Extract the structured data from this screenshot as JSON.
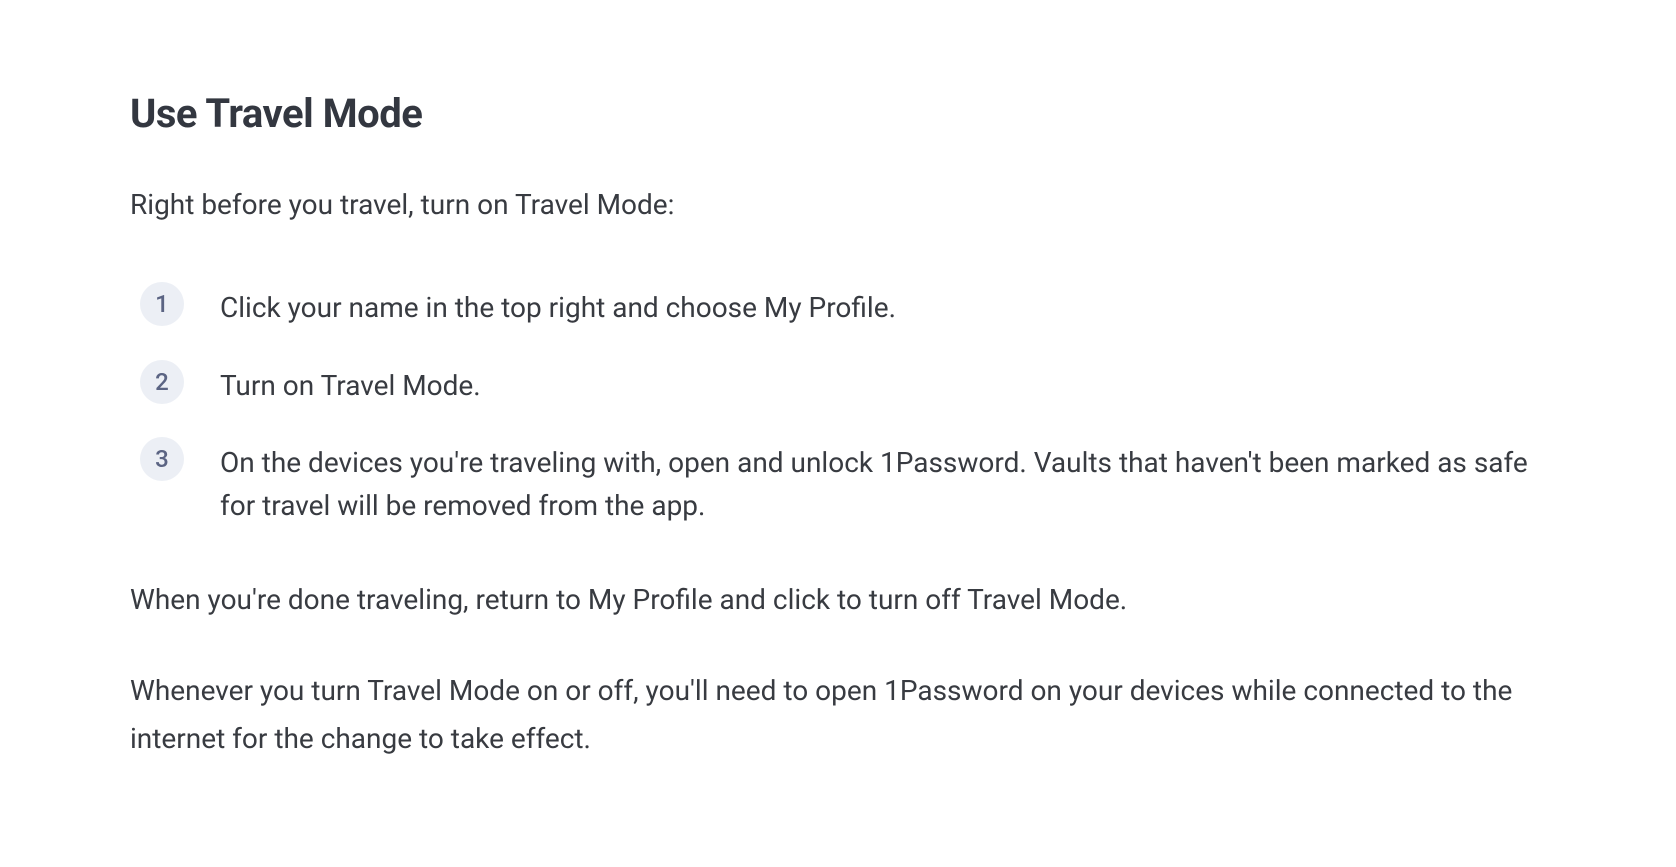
{
  "heading": "Use Travel Mode",
  "intro": "Right before you travel, turn on Travel Mode:",
  "steps": [
    {
      "num": "1",
      "text": "Click your name in the top right and choose My Profile."
    },
    {
      "num": "2",
      "text": "Turn on Travel Mode."
    },
    {
      "num": "3",
      "text": "On the devices you're traveling with, open and unlock 1Password. Vaults that haven't been marked as safe for travel will be removed from the app."
    }
  ],
  "para1": "When you're done traveling, return to My Profile and click to turn off Travel Mode.",
  "para2": "Whenever you turn Travel Mode on or off, you'll need to open 1Password on your devices while connected to the internet for the change to take effect."
}
